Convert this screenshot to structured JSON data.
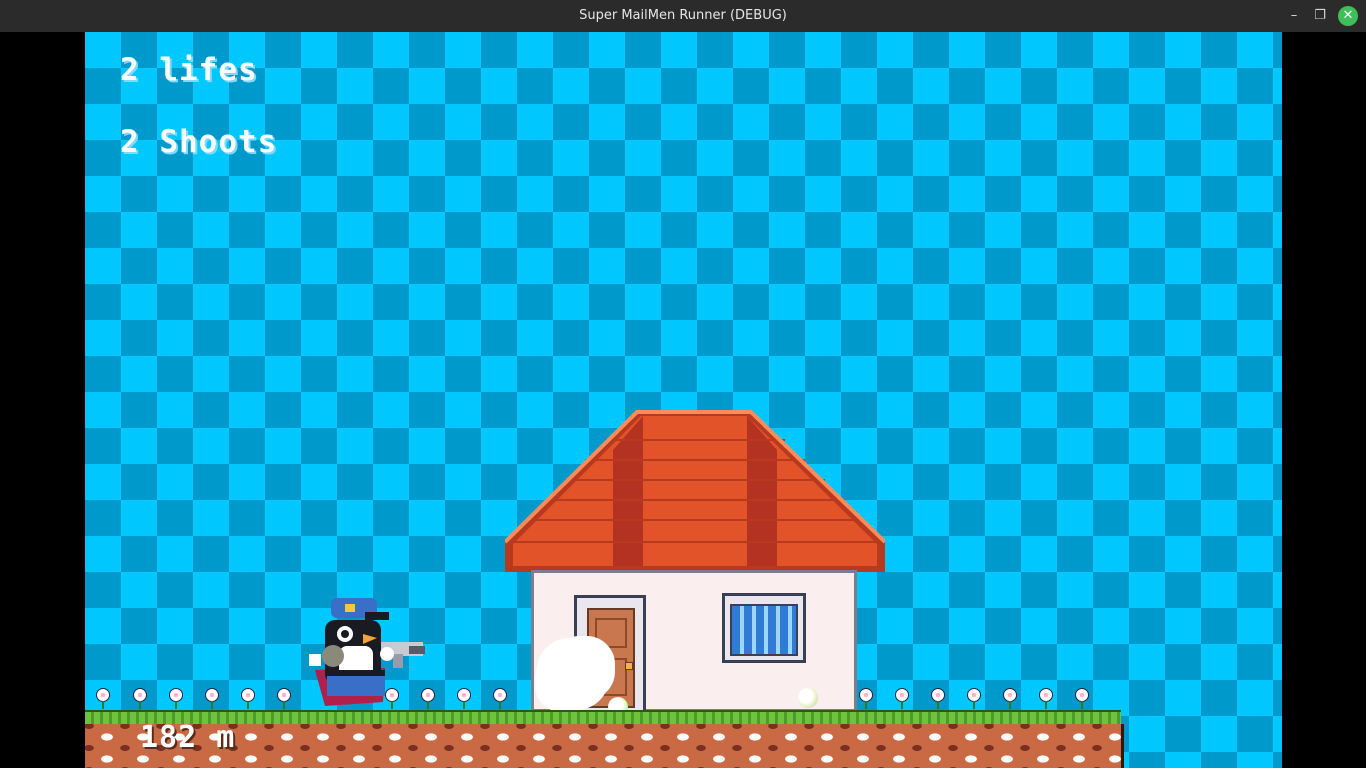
{
  "window": {
    "title": "Super MailMen Runner (DEBUG)",
    "minimize_glyph": "–",
    "maximize_glyph": "❐",
    "close_glyph": "✕"
  },
  "hud": {
    "lives": "2 lifes",
    "shoots": "2 Shoots",
    "distance": "182 m"
  },
  "colors": {
    "sky_light": "#00c8ff",
    "sky_dark": "#0099cc",
    "roof": "#e2532a",
    "grass": "#6ec23c",
    "dirt": "#c96a45",
    "close_button": "#3fbf5a"
  },
  "scene": {
    "player_icon": "mailman-penguin-icon",
    "house_icon": "house-icon",
    "smoke_icon": "smoke-puff-icon",
    "pellet_icon": "pellet-icon",
    "flower_icon": "flower-icon"
  }
}
